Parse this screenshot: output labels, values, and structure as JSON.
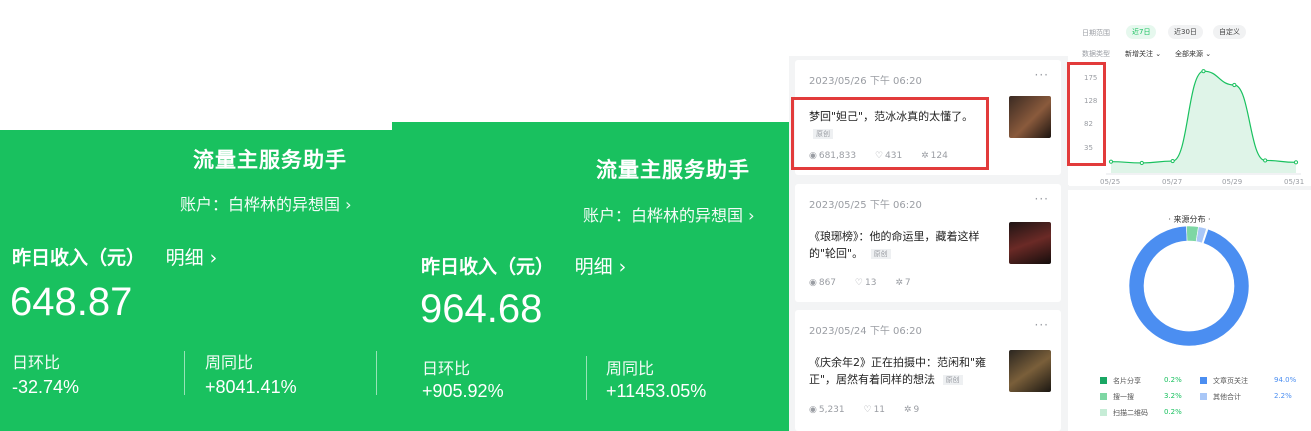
{
  "cards": [
    {
      "title": "流量主服务助手",
      "account": "账户：白桦林的异想国 ›",
      "income_label": "昨日收入（元）",
      "detail_link": "明细 ›",
      "amount": "648.87",
      "dod_label": "日环比",
      "dod_value": "-32.74%",
      "wow_label": "周同比",
      "wow_value": "+8041.41%"
    },
    {
      "title": "流量主服务助手",
      "account": "账户：白桦林的异想国 ›",
      "income_label": "昨日收入（元）",
      "detail_link": "明细 ›",
      "amount": "964.68",
      "dod_label": "日环比",
      "dod_value": "+905.92%",
      "wow_label": "周同比",
      "wow_value": "+11453.05%"
    }
  ],
  "articles": [
    {
      "date": "2023/05/26 下午 06:20",
      "more": "···",
      "title": "梦回\"妲己\"，范冰冰真的太懂了。",
      "tag": "原创",
      "views": "681,833",
      "likes": "431",
      "shares": "124"
    },
    {
      "date": "2023/05/25 下午 06:20",
      "more": "···",
      "title": "《琅琊榜》：他的命运里，藏着这样的\"轮回\"。",
      "tag": "原创",
      "views": "867",
      "likes": "13",
      "shares": "7"
    },
    {
      "date": "2023/05/24 下午 06:20",
      "more": "···",
      "title": "《庆余年2》正在拍摄中：范闲和\"雍正\"，居然有着同样的想法",
      "tag": "原创",
      "views": "5,231",
      "likes": "11",
      "shares": "9"
    }
  ],
  "trend": {
    "date_range_label": "日期范围",
    "options": [
      "近7日",
      "近30日",
      "自定义"
    ],
    "active_option": "近7日",
    "data_type_label": "数据类型",
    "metric_select": "新增关注 ⌄",
    "source_select": "全部来源 ⌄",
    "accent": "#19c15f"
  },
  "chart_data": [
    {
      "type": "area",
      "x": [
        "05/25",
        "05/26",
        "05/27",
        "05/28",
        "05/29",
        "05/30",
        "05/31"
      ],
      "x_tick_labels": [
        "05/25",
        "05/27",
        "05/29",
        "05/31"
      ],
      "y_tick_labels": [
        "175",
        "128",
        "82",
        "35"
      ],
      "ylim": [
        10,
        185
      ],
      "values": [
        28,
        26,
        29,
        172,
        150,
        30,
        27
      ],
      "grid": false,
      "color": "#19c15f"
    },
    {
      "type": "pie",
      "title": "· 来源分布 ·",
      "slices": [
        {
          "label": "名片分享",
          "value": 0.2,
          "pct": "0.2%",
          "color": "#1aa764"
        },
        {
          "label": "文章页关注",
          "value": 94.0,
          "pct": "94.0%",
          "color": "#4b8ef1"
        },
        {
          "label": "搜一搜",
          "value": 3.2,
          "pct": "3.2%",
          "color": "#7ed7a4"
        },
        {
          "label": "其他合计",
          "value": 2.2,
          "pct": "2.2%",
          "color": "#a9c7f7"
        },
        {
          "label": "扫描二维码",
          "value": 0.2,
          "pct": "0.2%",
          "color": "#c6ecd6"
        }
      ]
    }
  ]
}
